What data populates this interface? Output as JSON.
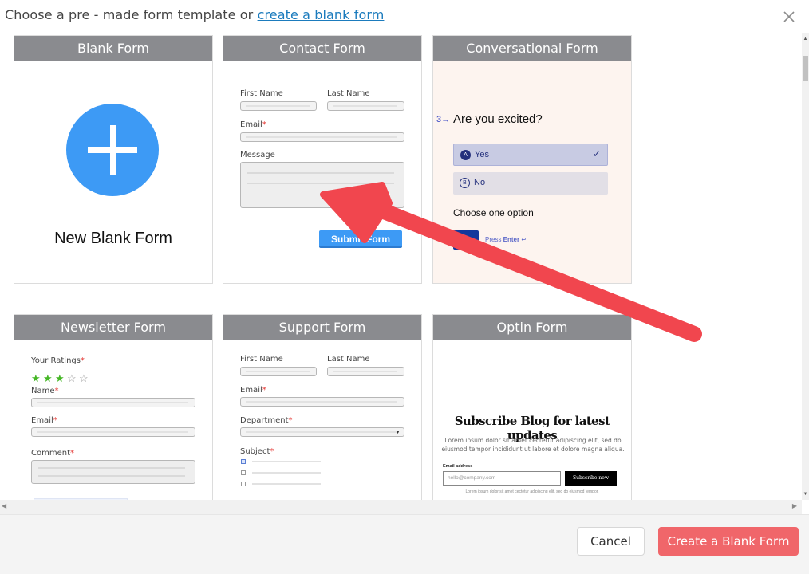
{
  "header": {
    "title_prefix": "Choose a pre - made form template or ",
    "title_link": "create a blank form"
  },
  "cards": {
    "blank": {
      "title": "Blank Form",
      "label": "New Blank Form"
    },
    "contact": {
      "title": "Contact Form",
      "first_name": "First Name",
      "last_name": "Last Name",
      "email": "Email",
      "message": "Message",
      "submit": "Submit Form"
    },
    "conversational": {
      "title": "Conversational Form",
      "number": "3→",
      "question": "Are you excited?",
      "option_a_key": "A",
      "option_a": "Yes",
      "option_b_key": "B",
      "option_b": "No",
      "hint": "Choose one option",
      "ok": "OK",
      "press_prefix": "Press ",
      "press_key": "Enter",
      "press_symbol": " ↵"
    },
    "newsletter": {
      "title": "Newsletter Form",
      "ratings": "Your Ratings",
      "rating_value": 3,
      "rating_max": 5,
      "name": "Name",
      "email": "Email",
      "comment": "Comment"
    },
    "support": {
      "title": "Support Form",
      "first_name": "First Name",
      "last_name": "Last Name",
      "email": "Email",
      "department": "Department",
      "subject": "Subject"
    },
    "optin": {
      "title": "Optin Form",
      "headline": "Subscribe Blog for latest updates",
      "description": "Lorem ipsum dolor sit amet cectetur adipiscing elit, sed do eiusmod tempor incididunt ut labore et dolore magna aliqua.",
      "email_label": "Email address",
      "email_placeholder": "hello@company.com",
      "button": "Subscribe now",
      "fine_print": "Lorem ipsum dolor sit amet cectetur adipiscing elit, sed do eiusmod tempor."
    }
  },
  "footer": {
    "cancel": "Cancel",
    "create": "Create a Blank Form"
  },
  "colors": {
    "accent": "#3d9af5",
    "primary_button": "#f0666a",
    "card_header": "#8a8b8f",
    "arrow": "#f1464e",
    "link": "#1b7bbd"
  }
}
